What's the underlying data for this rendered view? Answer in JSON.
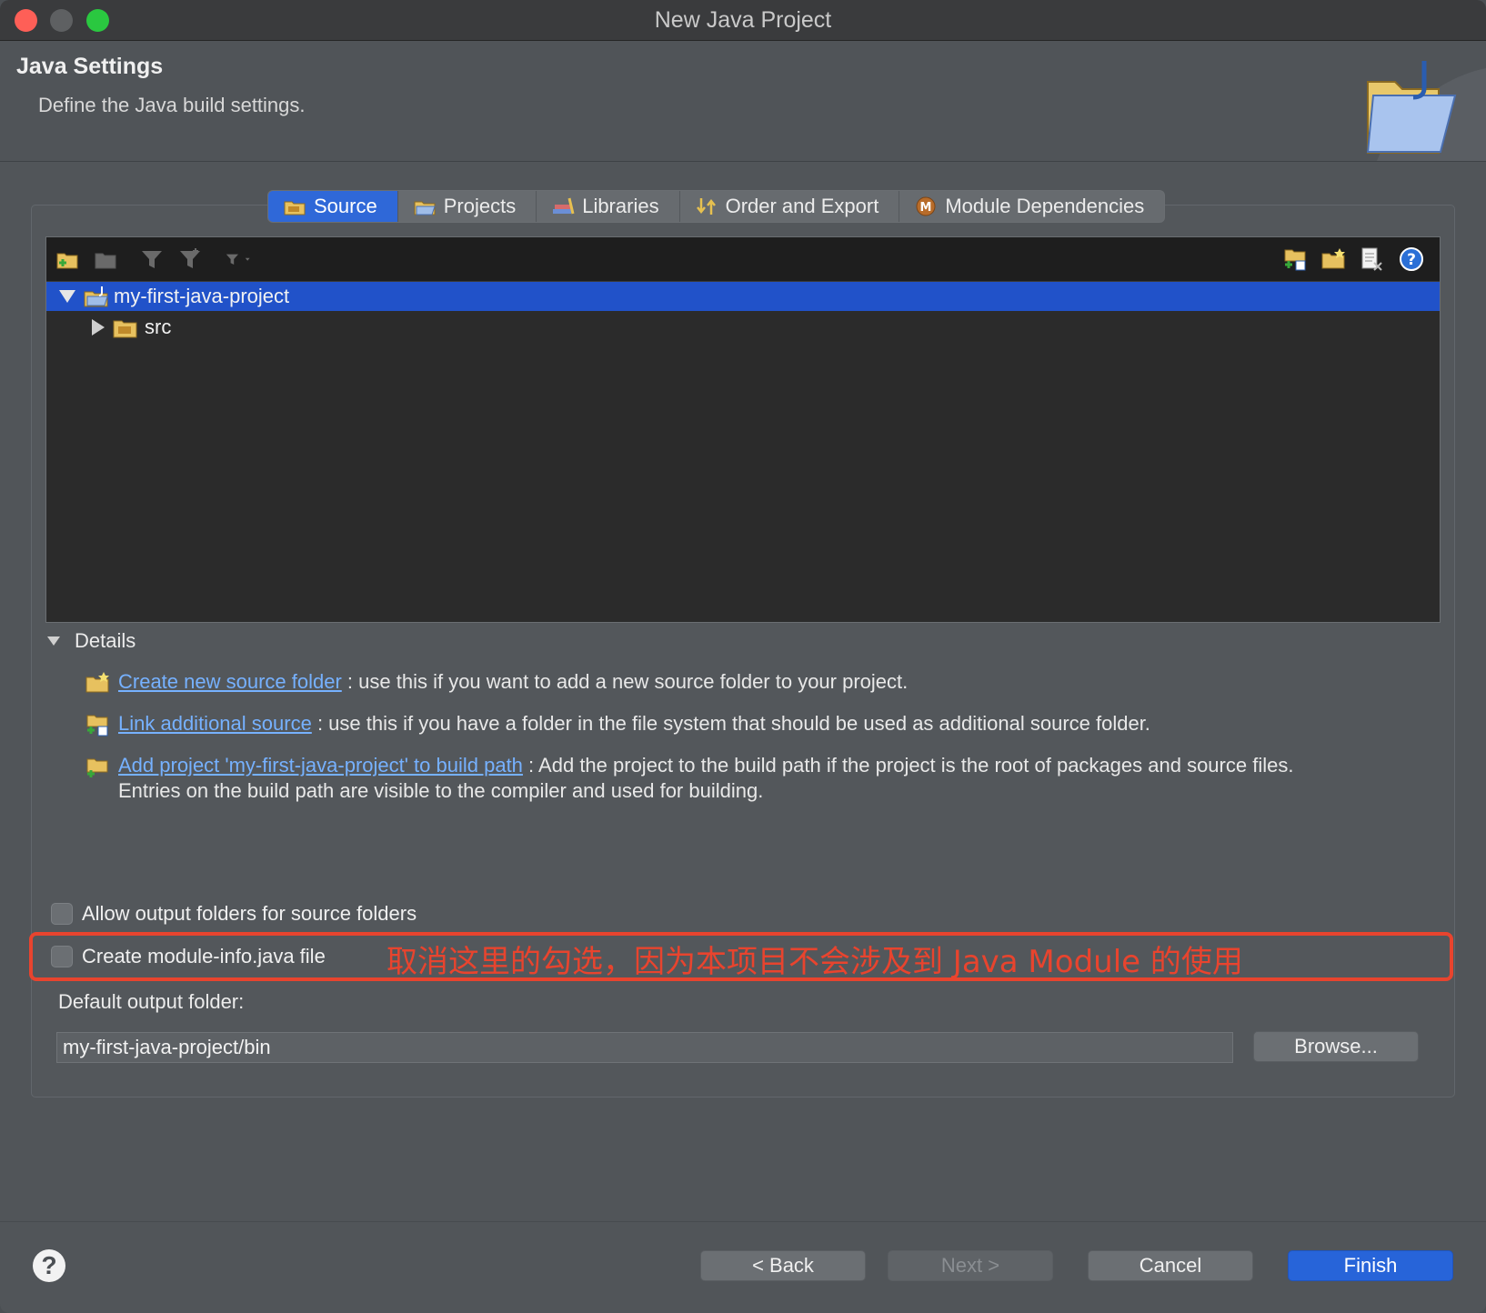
{
  "window": {
    "title": "New Java Project"
  },
  "banner": {
    "title": "Java Settings",
    "subtitle": "Define the Java build settings."
  },
  "tabs": [
    {
      "label": "Source",
      "icon": "source-folder-icon",
      "active": true
    },
    {
      "label": "Projects",
      "icon": "projects-icon",
      "active": false
    },
    {
      "label": "Libraries",
      "icon": "libraries-icon",
      "active": false
    },
    {
      "label": "Order and Export",
      "icon": "order-export-icon",
      "active": false
    },
    {
      "label": "Module Dependencies",
      "icon": "module-icon",
      "active": false
    }
  ],
  "tree": {
    "items": [
      {
        "label": "my-first-java-project",
        "expanded": true,
        "selected": true
      },
      {
        "label": "src",
        "expanded": false,
        "selected": false
      }
    ]
  },
  "details": {
    "header": "Details",
    "rows": [
      {
        "link": "Create new source folder",
        "text": ": use this if you want to add a new source folder to your project."
      },
      {
        "link": "Link additional source",
        "text": ": use this if you have a folder in the file system that should be used as additional source folder."
      },
      {
        "link": "Add project 'my-first-java-project' to build path",
        "text": ": Add the project to the build path if the project is the root of packages and source files.",
        "text2": "Entries on the build path are visible to the compiler and used for building."
      }
    ]
  },
  "options": {
    "allow_output": "Allow output folders for source folders",
    "create_module_info": "Create module-info.java file"
  },
  "annotation": "取消这里的勾选，因为本项目不会涉及到 Java Module 的使用",
  "output": {
    "label": "Default output folder:",
    "value": "my-first-java-project/bin",
    "browse": "Browse..."
  },
  "footer": {
    "help": "?",
    "back": "< Back",
    "next": "Next >",
    "cancel": "Cancel",
    "finish": "Finish"
  },
  "colors": {
    "accent": "#2764d9",
    "annotation": "#e8442e",
    "link": "#76b1ff"
  }
}
